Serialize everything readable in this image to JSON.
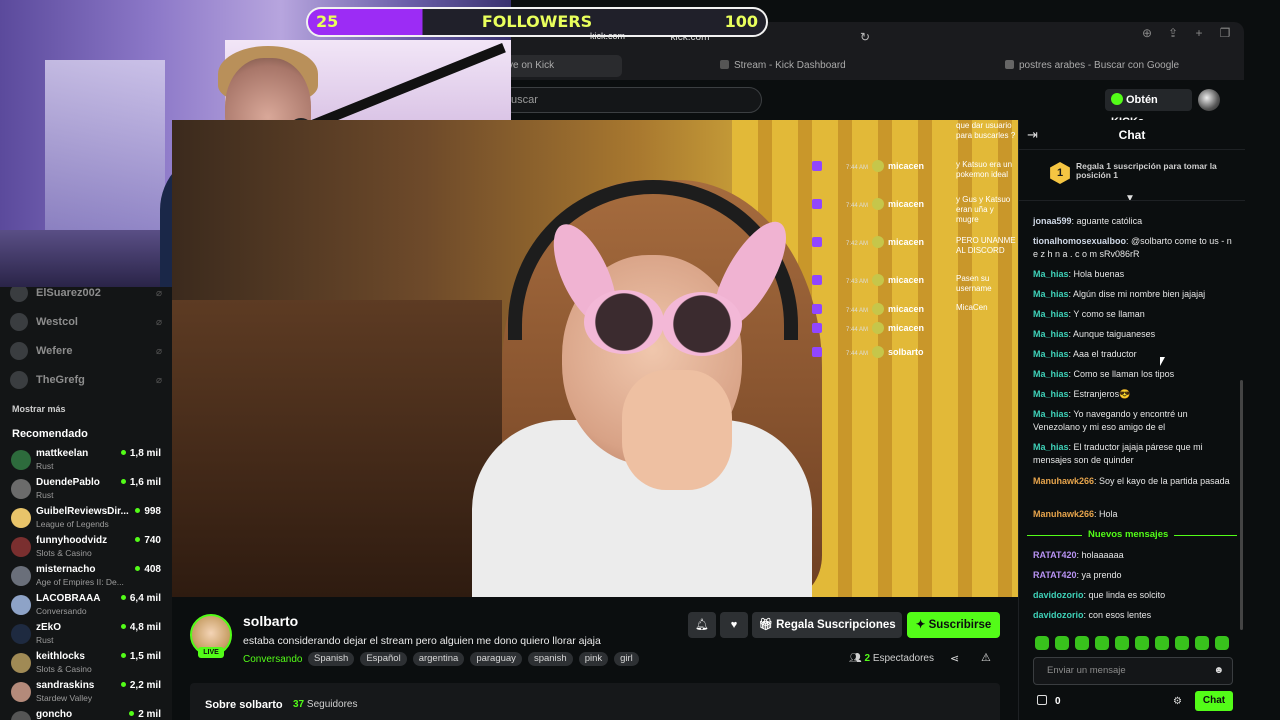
{
  "browser": {
    "url": "kick.com",
    "tabs": [
      {
        "label": "ve on Kick"
      },
      {
        "label": "Stream - Kick Dashboard"
      },
      {
        "label": "postres arabes - Buscar con Google"
      }
    ]
  },
  "overlay": {
    "followers_current": "25",
    "followers_label": "FOLLOWERS",
    "followers_goal": "100",
    "followers_progress_fraction": 0.25
  },
  "header": {
    "search_placeholder": "uscar",
    "kicks_label": "Obtén KICKs"
  },
  "sidebar": {
    "following": [
      {
        "name": "ElSuarez002"
      },
      {
        "name": "Westcol"
      },
      {
        "name": "Wefere"
      },
      {
        "name": "TheGrefg"
      }
    ],
    "show_more": "Mostrar más",
    "recommended_title": "Recomendado",
    "recommended": [
      {
        "name": "mattkeelan",
        "category": "Rust",
        "viewers": "1,8 mil",
        "color": "#2d6b3c"
      },
      {
        "name": "DuendePablo",
        "category": "Rust",
        "viewers": "1,6 mil",
        "color": "#6b6b6b"
      },
      {
        "name": "GuibelReviewsDir...",
        "category": "League of Legends",
        "viewers": "998",
        "color": "#e8c46a"
      },
      {
        "name": "funnyhoodvidz",
        "category": "Slots & Casino",
        "viewers": "740",
        "color": "#7a2f2f"
      },
      {
        "name": "misternacho",
        "category": "Age of Empires II: De...",
        "viewers": "408",
        "color": "#6a6f7a"
      },
      {
        "name": "LACOBRAAA",
        "category": "Conversando",
        "viewers": "6,4 mil",
        "color": "#8ea3c7"
      },
      {
        "name": "zEkO",
        "category": "Rust",
        "viewers": "4,8 mil",
        "color": "#1e2a40"
      },
      {
        "name": "keithlocks",
        "category": "Slots & Casino",
        "viewers": "1,5 mil",
        "color": "#a08a55"
      },
      {
        "name": "sandraskins",
        "category": "Stardew Valley",
        "viewers": "2,2 mil",
        "color": "#b48a7a"
      },
      {
        "name": "goncho",
        "category": "",
        "viewers": "2 mil",
        "color": "#555"
      }
    ]
  },
  "stream": {
    "streamer": "solbarto",
    "live_badge": "LIVE",
    "title": "estaba considerando dejar el stream pero alguien me dono quiero llorar ajaja",
    "category": "Conversando",
    "tags": [
      "Spanish",
      "Español",
      "argentina",
      "paraguay",
      "spanish",
      "pink",
      "girl"
    ],
    "gift_subs_label": "Regala Suscripciones",
    "subscribe_label": "Suscribirse",
    "viewers_count": "2",
    "viewers_label": "Espectadores",
    "about_label": "Sobre solbarto",
    "followers_count": "37",
    "followers_label": "Seguidores"
  },
  "ingame_chat": {
    "rows": [
      {
        "time": "7:44 AM",
        "user": "micacen"
      },
      {
        "time": "7:44 AM",
        "user": "micacen"
      },
      {
        "time": "7:42 AM",
        "user": "micacen"
      },
      {
        "time": "7:43 AM",
        "user": "micacen"
      },
      {
        "time": "7:44 AM",
        "user": "micacen"
      },
      {
        "time": "7:44 AM",
        "user": "micacen"
      },
      {
        "time": "7:44 AM",
        "user": "solbarto"
      }
    ],
    "messages": [
      "que dar usuario para buscarles ?",
      "y Katsuo era un pokemon ideal",
      "y Gus y Katsuo eran uña y mugre",
      "PERO UNANME AL DISCORD",
      "Pasen su username",
      "MicaCen"
    ]
  },
  "chat": {
    "title": "Chat",
    "gift_position": "1",
    "gift_text": "Regala 1 suscripción para tomar la posición 1",
    "messages": [
      {
        "user": "jonaa599",
        "text": "aguante católica",
        "color": "#cfd8e6"
      },
      {
        "user": "tionalhomosexualboo",
        "text": "@solbarto come to us - n e z h n a . c o m sRv086rR",
        "color": "#cfd8e6"
      },
      {
        "user": "Ma_hias",
        "text": "Hola buenas",
        "color": "#3fd1b8"
      },
      {
        "user": "Ma_hias",
        "text": "Algún dise mi nombre bien jajajaj",
        "color": "#3fd1b8"
      },
      {
        "user": "Ma_hias",
        "text": "Y como se llaman",
        "color": "#3fd1b8"
      },
      {
        "user": "Ma_hias",
        "text": "Aunque taiguaneses",
        "color": "#3fd1b8"
      },
      {
        "user": "Ma_hias",
        "text": "Aaa el traductor",
        "color": "#3fd1b8"
      },
      {
        "user": "Ma_hias",
        "text": "Como se llaman los tipos",
        "color": "#3fd1b8"
      },
      {
        "user": "Ma_hias",
        "text": "Estranjeros😎",
        "color": "#3fd1b8"
      },
      {
        "user": "Ma_hias",
        "text": "Yo navegando y encontré un Venezolano y mi eso amigo de el",
        "color": "#3fd1b8"
      },
      {
        "user": "Ma_hias",
        "text": "El traductor jajaja párese que mi mensajes son de quinder",
        "color": "#3fd1b8"
      },
      {
        "user": "Manuhawk266",
        "text": "Soy el kayo de la partida pasada",
        "color": "#e6a44c"
      },
      {
        "user": "Manuhawk266",
        "text": "Hola",
        "color": "#e6a44c"
      }
    ],
    "new_messages_label": "Nuevos mensajes",
    "new_messages": [
      {
        "user": "RATAT420",
        "text": "holaaaaaa",
        "color": "#b792f2"
      },
      {
        "user": "RATAT420",
        "text": "ya prendo",
        "color": "#b792f2"
      },
      {
        "user": "davidozorio",
        "text": "que linda es solcito",
        "color": "#3fd1b8"
      },
      {
        "user": "davidozorio",
        "text": "con esos lentes",
        "color": "#3fd1b8"
      }
    ],
    "input_placeholder": "Enviar un mensaje",
    "kicks_count": "0",
    "send_label": "Chat"
  }
}
